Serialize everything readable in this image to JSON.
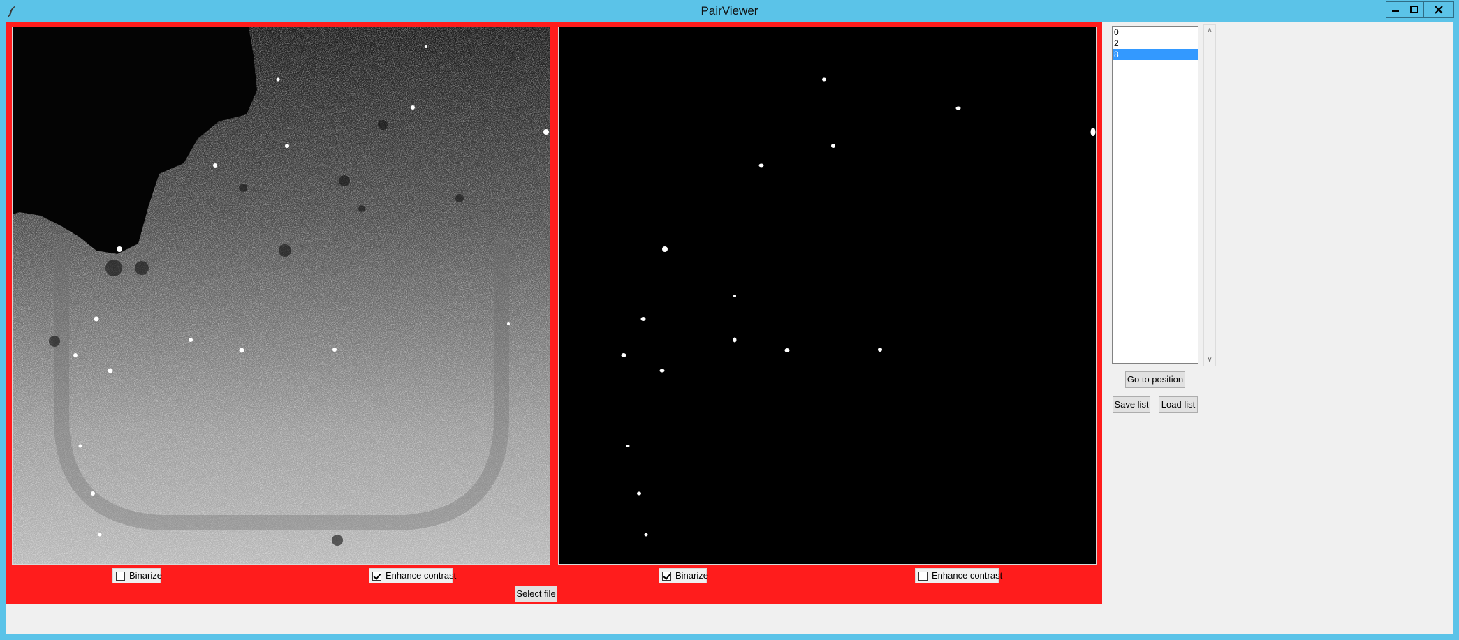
{
  "window": {
    "title": "PairViewer"
  },
  "left_panel": {
    "binarize_label": "Binarize",
    "binarize_checked": false,
    "enhance_label": "Enhance contrast",
    "enhance_checked": true
  },
  "right_panel": {
    "binarize_label": "Binarize",
    "binarize_checked": true,
    "enhance_label": "Enhance contrast",
    "enhance_checked": false
  },
  "select_file_label": "Select file",
  "position_list": {
    "items": [
      "0",
      "2",
      "8"
    ],
    "selected_index": 2
  },
  "goto_label": "Go to position",
  "save_label": "Save list",
  "load_label": "Load list",
  "colors": {
    "titlebar": "#5bc3e8",
    "panel_bg": "#ff1c1c",
    "selection": "#3399ff"
  }
}
